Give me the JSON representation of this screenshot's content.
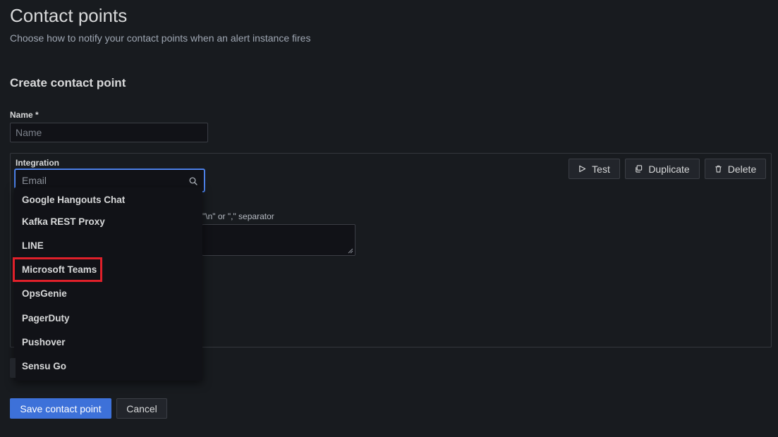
{
  "header": {
    "title": "Contact points",
    "subtitle": "Choose how to notify your contact points when an alert instance fires"
  },
  "form": {
    "section_title": "Create contact point",
    "name_label": "Name *",
    "name_placeholder": "Name",
    "name_value": "",
    "integration_label": "Integration",
    "integration_placeholder": "Email",
    "hint_partial": "\"\\n\" or \",\" separator"
  },
  "integration_actions": {
    "test_label": "Test",
    "duplicate_label": "Duplicate",
    "delete_label": "Delete"
  },
  "dropdown": {
    "items": [
      "Google Hangouts Chat",
      "Kafka REST Proxy",
      "LINE",
      "Microsoft Teams",
      "OpsGenie",
      "PagerDuty",
      "Pushover",
      "Sensu Go"
    ],
    "highlighted_item": "Microsoft Teams"
  },
  "footer": {
    "save_label": "Save contact point",
    "cancel_label": "Cancel"
  },
  "colors": {
    "background": "#181b1f",
    "primary": "#3d71d9",
    "highlight": "#e0202a"
  },
  "icons": {
    "search": "search-icon",
    "test": "play-icon",
    "duplicate": "copy-icon",
    "delete": "trash-icon"
  }
}
